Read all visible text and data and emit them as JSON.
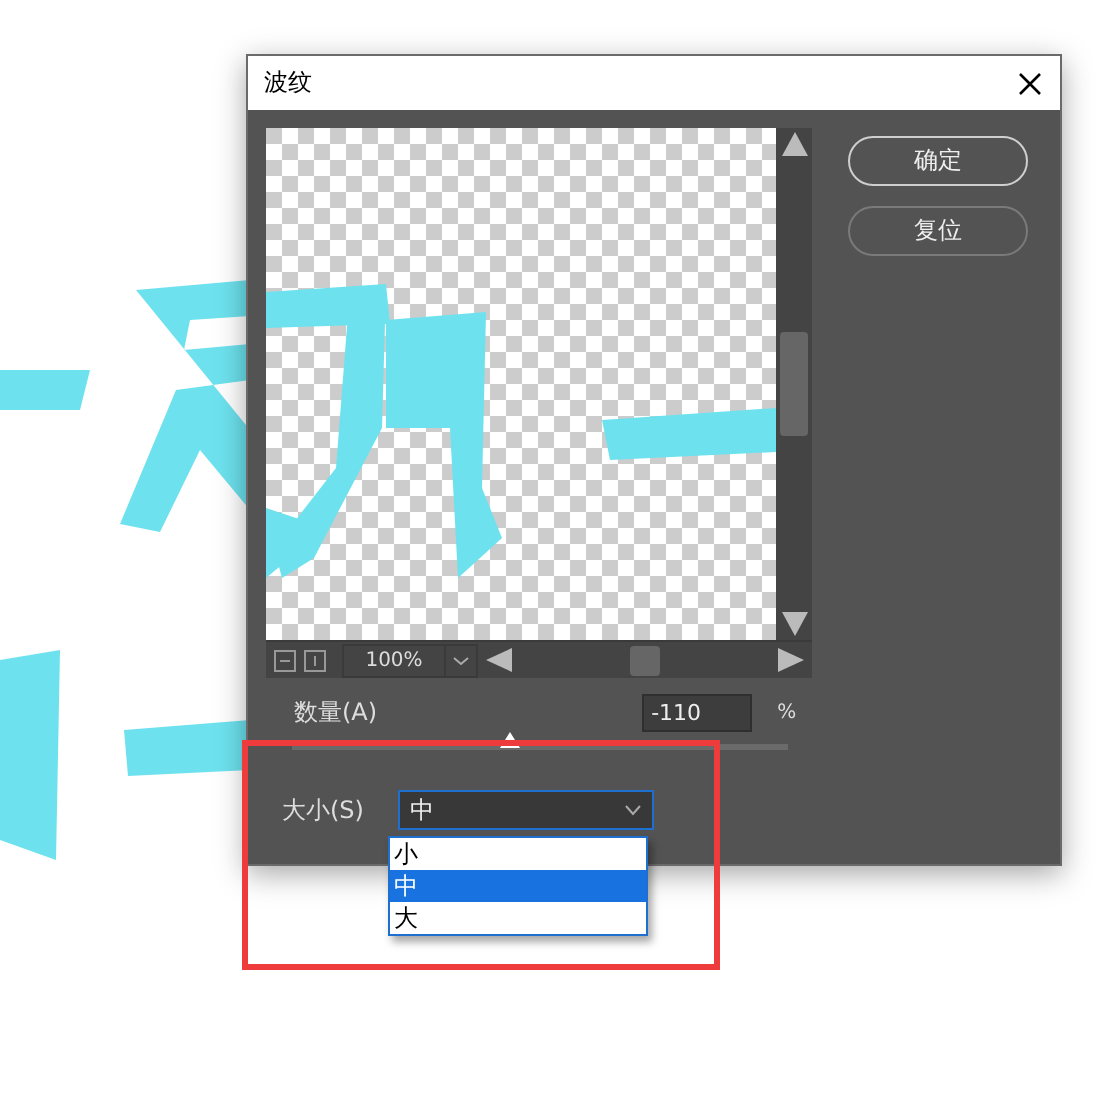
{
  "window": {
    "title": "波纹"
  },
  "preview": {
    "kind": "picture",
    "zoom": "100%"
  },
  "buttons": [
    {
      "label": "确定",
      "default": true
    },
    {
      "label": "复位",
      "default": false
    }
  ],
  "amount": {
    "label": "数量(A)",
    "value": "-110",
    "unit": "%",
    "level": 0.44
  },
  "size": {
    "label": "大小(S)",
    "value": "中",
    "options": [
      {
        "label": "小",
        "selected": false
      },
      {
        "label": "中",
        "selected": true
      },
      {
        "label": "大",
        "selected": false
      }
    ]
  }
}
